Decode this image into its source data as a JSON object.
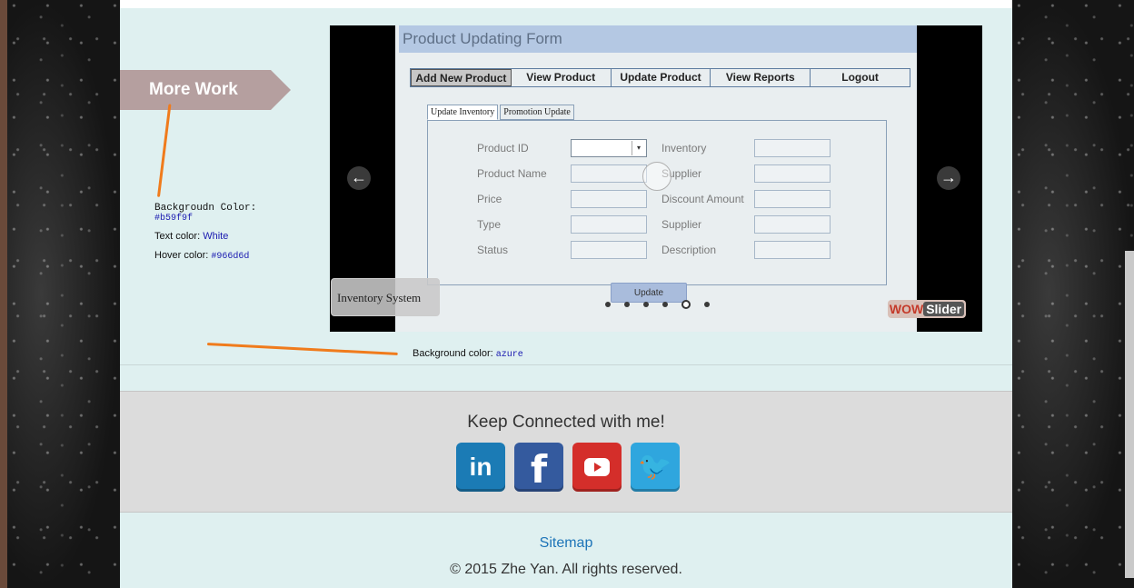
{
  "more_work": {
    "label": "More Work",
    "color": "#b59f9f"
  },
  "annotations": {
    "bg_label": "Backgroudn Color:",
    "bg_value": "#b59f9f",
    "text_label": "Text color:",
    "text_value": "White",
    "hover_label": "Hover color:",
    "hover_value": "#966d6d",
    "page_bg_label": "Background color:",
    "page_bg_value": "azure"
  },
  "slider": {
    "form_title": "Product Updating Form",
    "nav": [
      "Add New Product",
      "View Product",
      "Update Product",
      "View Reports",
      "Logout"
    ],
    "tabs": [
      "Update Inventory",
      "Promotion Update"
    ],
    "left_fields": [
      "Product ID",
      "Product Name",
      "Price",
      "Type",
      "Status"
    ],
    "right_fields": [
      "Inventory",
      "Supplier",
      "Discount Amount",
      "Supplier",
      "Description"
    ],
    "update_label": "Update",
    "caption": "Inventory System",
    "watermark_a": "WOW",
    "watermark_b": "Slider",
    "bullet_count": 6,
    "active_bullet": 4
  },
  "footer": {
    "connect_title": "Keep Connected with me!",
    "linkedin": "in",
    "facebook": "f",
    "twitter": "🐦",
    "sitemap": "Sitemap",
    "copyright": "© 2015 Zhe Yan. All rights reserved."
  }
}
